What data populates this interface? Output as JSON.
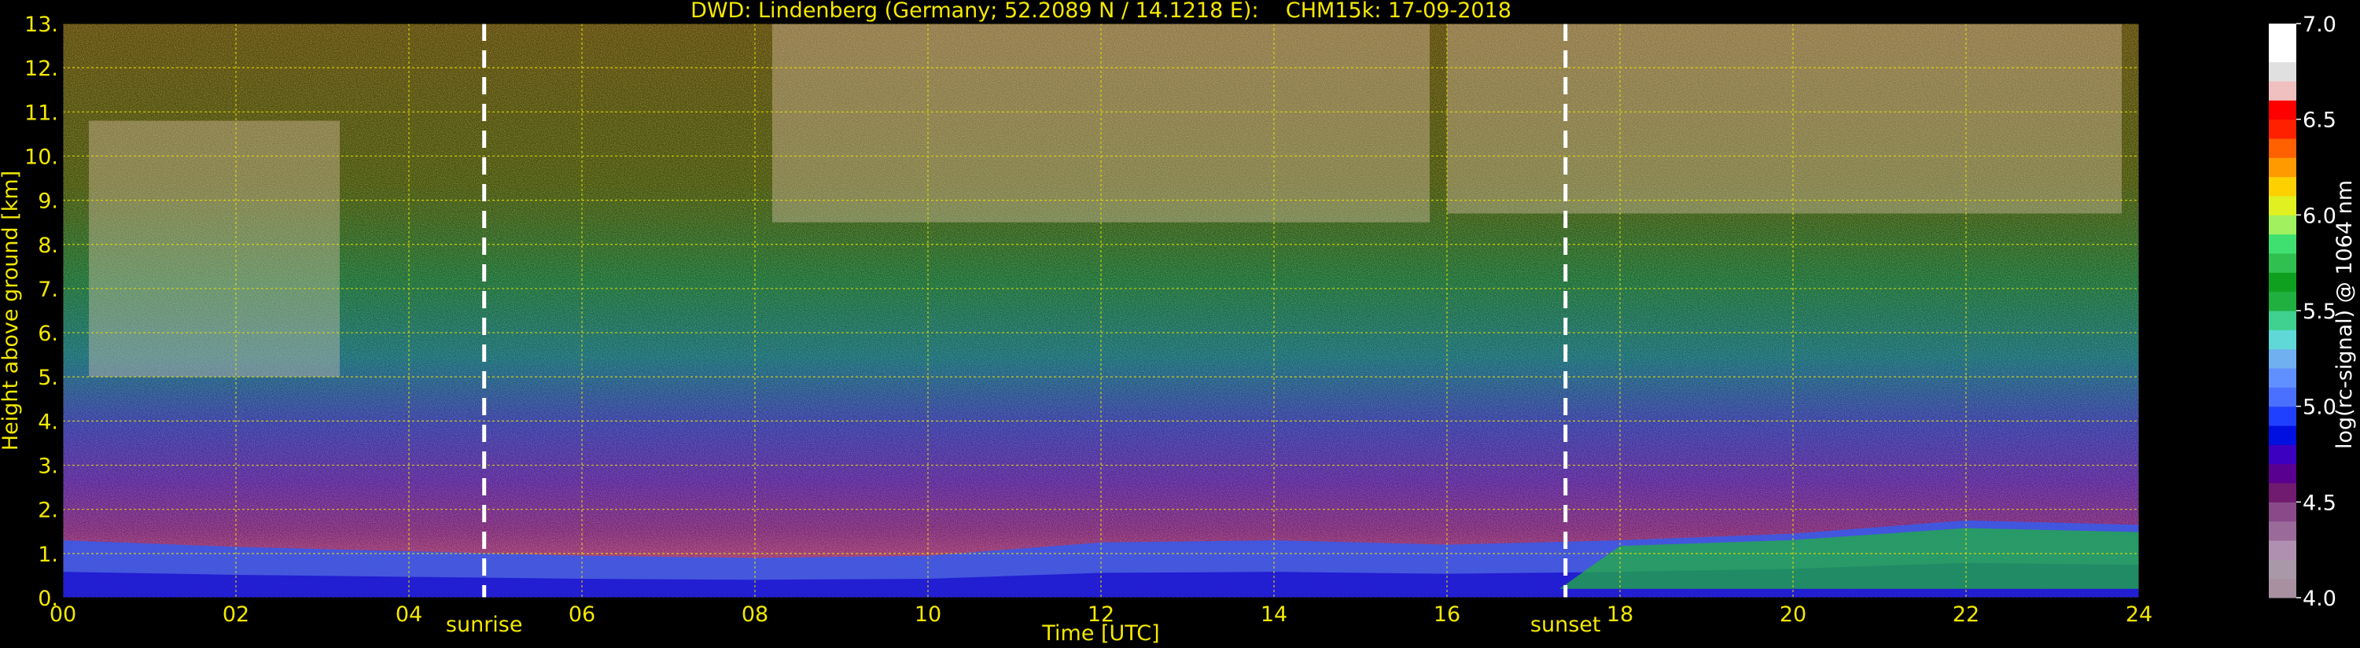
{
  "chart_data": {
    "type": "heatmap",
    "title": "DWD: Lindenberg (Germany; 52.2089 N / 14.1218 E):    CHM15k: 17-09-2018",
    "xlabel": "Time [UTC]",
    "ylabel": "Height above ground [km]",
    "xlim": [
      0,
      24
    ],
    "ylim": [
      0,
      13
    ],
    "x_ticks": [
      "00",
      "02",
      "04",
      "06",
      "08",
      "10",
      "12",
      "14",
      "16",
      "18",
      "20",
      "22",
      "24"
    ],
    "y_ticks": [
      "0.",
      "1.",
      "2.",
      "3.",
      "4.",
      "5.",
      "6.",
      "7.",
      "8.",
      "9.",
      "10.",
      "11.",
      "12.",
      "13."
    ],
    "grid": true,
    "markers": [
      {
        "label": "sunrise",
        "x": 4.87
      },
      {
        "label": "sunset",
        "x": 17.37
      }
    ],
    "colorbar": {
      "label": "log(rc-signal) @ 1064 nm",
      "range": [
        4.0,
        7.0
      ],
      "ticks": [
        "4.0",
        "4.5",
        "5.0",
        "5.5",
        "6.0",
        "6.5",
        "7.0"
      ],
      "colors": [
        "#a890a0",
        "#a898a8",
        "#b090b0",
        "#9a6a9a",
        "#8a4a8a",
        "#701a70",
        "#5a0090",
        "#3c00c0",
        "#0010e0",
        "#2040ff",
        "#4a70ff",
        "#6090ff",
        "#70b0f0",
        "#60d8d8",
        "#40d090",
        "#20b040",
        "#10a020",
        "#30c050",
        "#40e070",
        "#a0f060",
        "#e0f020",
        "#ffd000",
        "#ff9a00",
        "#ff6000",
        "#ff2000",
        "#ff0000",
        "#f0c0c0",
        "#e0e0e0",
        "#ffffff",
        "#ffffff"
      ]
    },
    "features": {
      "boundary_layer_top_km": [
        {
          "x": 0,
          "y": 1.3
        },
        {
          "x": 2,
          "y": 1.15
        },
        {
          "x": 4,
          "y": 1.05
        },
        {
          "x": 6,
          "y": 0.95
        },
        {
          "x": 8,
          "y": 0.9
        },
        {
          "x": 10,
          "y": 0.95
        },
        {
          "x": 12,
          "y": 1.25
        },
        {
          "x": 14,
          "y": 1.3
        },
        {
          "x": 16,
          "y": 1.2
        },
        {
          "x": 18,
          "y": 1.3
        },
        {
          "x": 20,
          "y": 1.45
        },
        {
          "x": 22,
          "y": 1.75
        },
        {
          "x": 24,
          "y": 1.65
        }
      ],
      "cirrus_clouds": [
        {
          "x_start": 0.3,
          "x_end": 3.2,
          "y_bottom": 5.0,
          "y_top": 10.8
        },
        {
          "x_start": 8.2,
          "x_end": 15.8,
          "y_bottom": 8.5,
          "y_top": 13.0
        },
        {
          "x_start": 16.0,
          "x_end": 23.8,
          "y_bottom": 8.7,
          "y_top": 13.0
        }
      ]
    }
  }
}
